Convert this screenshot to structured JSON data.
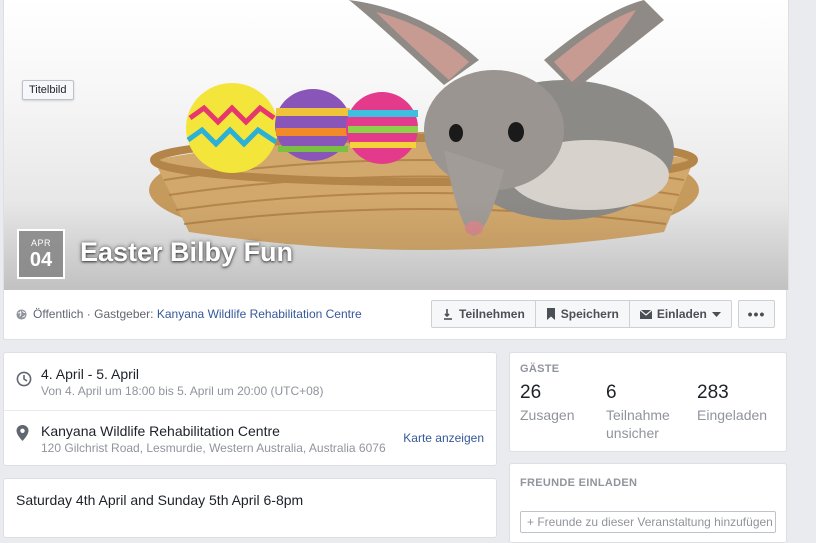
{
  "cover": {
    "tag": "Titelbild",
    "date_month": "APR",
    "date_day": "04",
    "title": "Easter Bilby Fun"
  },
  "meta": {
    "privacy": "Öffentlich · Gastgeber: ",
    "host": "Kanyana Wildlife Rehabilitation Centre"
  },
  "actions": {
    "going": "Teilnehmen",
    "save": "Speichern",
    "invite": "Einladen",
    "more": "•••"
  },
  "details": {
    "date_line": "4. April - 5. April",
    "time_line": "Von 4. April um 18:00 bis 5. April um 20:00 (UTC+08)",
    "location_name": "Kanyana Wildlife Rehabilitation Centre",
    "location_address": "120 Gilchrist Road, Lesmurdie, Western Australia, Australia 6076",
    "map_link": "Karte anzeigen"
  },
  "description": "Saturday 4th April and Sunday 5th April 6-8pm",
  "guests": {
    "heading": "GÄSTE",
    "going": {
      "count": "26",
      "label": "Zusagen"
    },
    "maybe": {
      "count": "6",
      "label_1": "Teilnahme",
      "label_2": "unsicher"
    },
    "invited": {
      "count": "283",
      "label": "Eingeladen"
    }
  },
  "invite_friends": {
    "heading": "FREUNDE EINLADEN",
    "placeholder": "+ Freunde zu dieser Veranstaltung hinzufügen"
  },
  "colors": {
    "link": "#365899",
    "page_bg": "#e9ebee",
    "muted": "#90949c"
  },
  "icons": [
    "globe-icon",
    "going-icon",
    "bookmark-icon",
    "envelope-icon",
    "caret-down-icon",
    "clock-icon",
    "location-pin-icon"
  ]
}
